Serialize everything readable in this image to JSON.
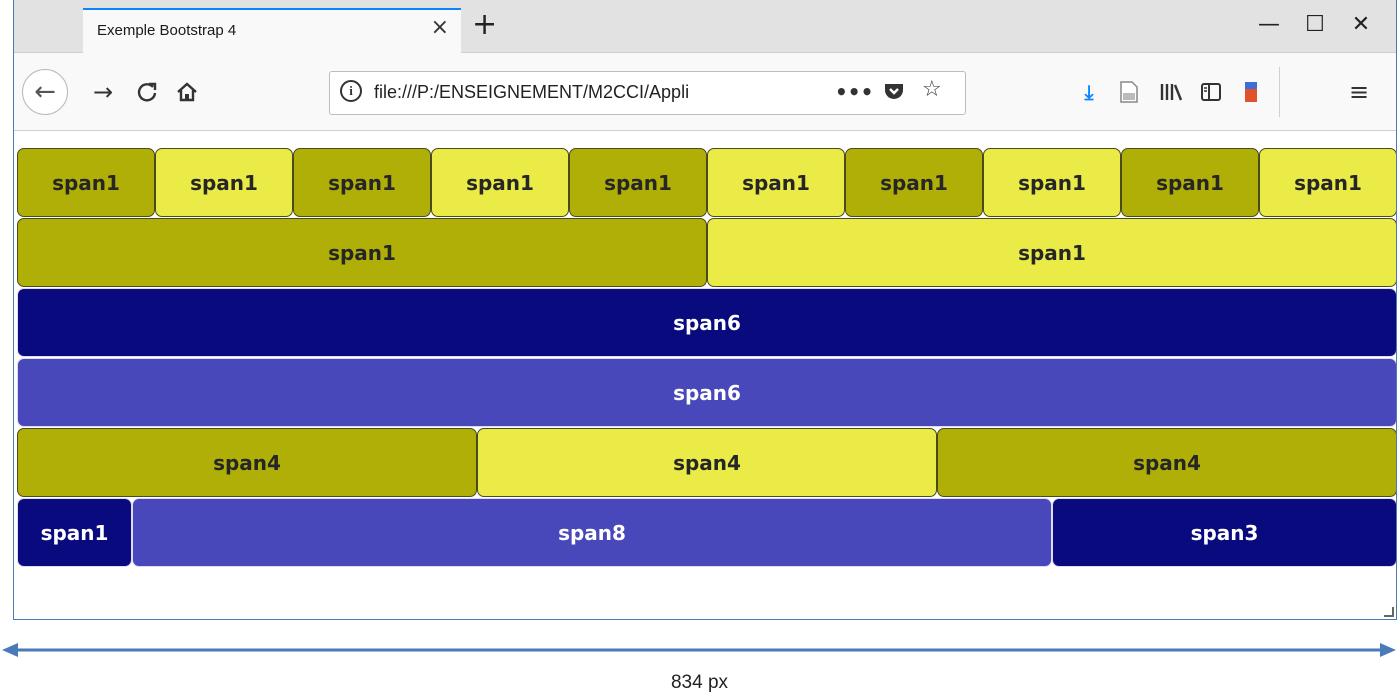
{
  "browser": {
    "tab_title": "Exemple Bootstrap 4",
    "tab_close": "×",
    "new_tab": "+",
    "win_minimize": "—",
    "win_maximize": "☐",
    "win_close": "✕",
    "url": "file:///P:/ENSEIGNEMENT/M2CCI/Appli",
    "icons": {
      "back": "back-arrow-icon",
      "forward": "forward-arrow-icon",
      "reload": "reload-icon",
      "home": "home-icon",
      "info": "info-icon",
      "more": "more-icon",
      "pocket": "pocket-icon",
      "bookmark": "star-icon",
      "download": "download-icon",
      "page": "page-icon",
      "library": "library-icon",
      "sidebar": "sidebar-icon",
      "extension": "extension-icon",
      "menu": "hamburger-menu-icon"
    }
  },
  "grid": {
    "row1": [
      "span1",
      "span1",
      "span1",
      "span1",
      "span1",
      "span1",
      "span1",
      "span1",
      "span1",
      "span1"
    ],
    "row2": [
      "span1",
      "span1"
    ],
    "row3": [
      "span6"
    ],
    "row4": [
      "span6"
    ],
    "row5": [
      "span4",
      "span4",
      "span4"
    ],
    "row6": [
      "span1",
      "span8",
      "span3"
    ]
  },
  "colors": {
    "yellow_dark": "#afaf08",
    "yellow_light": "#eaeb47",
    "blue_dark": "#0a0a7f",
    "blue_light": "#4848ba",
    "annotation": "#4a7ab8"
  },
  "annotation": {
    "width_label": "834 px"
  }
}
